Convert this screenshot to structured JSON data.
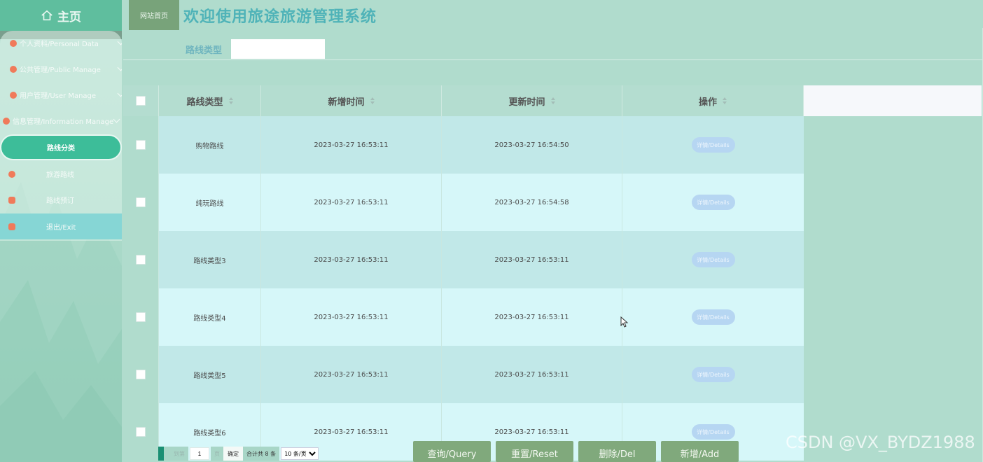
{
  "sidebar": {
    "home_label": "主页",
    "items": [
      {
        "label": "个人资料/Personal Data",
        "has_chevron": true
      },
      {
        "label": "公共管理/Public Manage",
        "has_chevron": true
      },
      {
        "label": "用户管理/User Manage",
        "has_chevron": true
      },
      {
        "label": "信息管理/Information Manage",
        "has_chevron": true
      },
      {
        "label": "路线分类",
        "active": true
      },
      {
        "label": "旅游路线"
      },
      {
        "label": "路线预订"
      },
      {
        "label": "退出/Exit"
      }
    ]
  },
  "topbar": {
    "home_tab": "网站首页",
    "title": "欢迎使用旅途旅游管理系统"
  },
  "search": {
    "label": "路线类型",
    "value": ""
  },
  "table": {
    "headers": [
      "路线类型",
      "新增时间",
      "更新时间",
      "操作"
    ],
    "rows": [
      {
        "type": "购物路线",
        "created": "2023-03-27 16:53:11",
        "updated": "2023-03-27 16:54:50",
        "action": "详情/Details"
      },
      {
        "type": "纯玩路线",
        "created": "2023-03-27 16:53:11",
        "updated": "2023-03-27 16:54:58",
        "action": "详情/Details"
      },
      {
        "type": "路线类型3",
        "created": "2023-03-27 16:53:11",
        "updated": "2023-03-27 16:53:11",
        "action": "详情/Details"
      },
      {
        "type": "路线类型4",
        "created": "2023-03-27 16:53:11",
        "updated": "2023-03-27 16:53:11",
        "action": "详情/Details"
      },
      {
        "type": "路线类型5",
        "created": "2023-03-27 16:53:11",
        "updated": "2023-03-27 16:53:11",
        "action": "详情/Details"
      },
      {
        "type": "路线类型6",
        "created": "2023-03-27 16:53:11",
        "updated": "2023-03-27 16:53:11",
        "action": "详情/Details"
      }
    ]
  },
  "pager": {
    "goto_label": "到第",
    "page_value": "1",
    "page_unit": "页",
    "confirm": "确定",
    "total": "合计共 8 条",
    "page_size": "10 条/页"
  },
  "actions": {
    "query": "查询/Query",
    "reset": "重置/Reset",
    "delete": "删除/Del",
    "add": "新增/Add"
  },
  "watermark": "CSDN @VX_BYDZ1988",
  "colors": {
    "background": "#b0dccd",
    "sidebar_active": "#3dbd99",
    "title": "#4fb3b8",
    "action_button": "#80a97c",
    "details_button": "#b6d6f2"
  }
}
